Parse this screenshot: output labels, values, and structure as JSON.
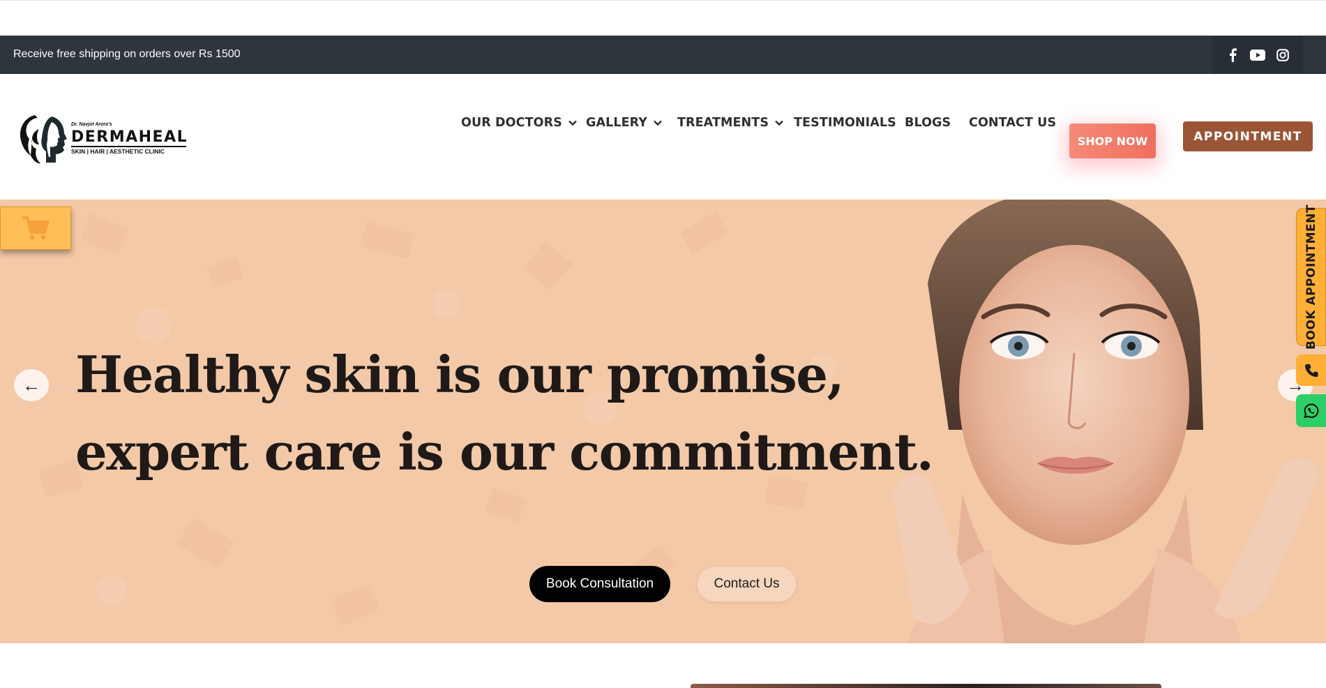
{
  "topbar": {
    "promo_text": "Receive free shipping on orders over Rs 1500",
    "social_icons": [
      "facebook-icon",
      "youtube-icon",
      "instagram-icon"
    ]
  },
  "header": {
    "logo": {
      "small_text": "Dr. Navjot Arora's",
      "brand": "DERMAHEAL",
      "tagline": "SKIN | HAIR | AESTHETIC CLINIC"
    },
    "nav": [
      {
        "label": "OUR DOCTORS",
        "has_dropdown": true
      },
      {
        "label": "GALLERY",
        "has_dropdown": true
      },
      {
        "label": "TREATMENTS",
        "has_dropdown": true
      },
      {
        "label": "TESTIMONIALS",
        "has_dropdown": false
      },
      {
        "label": "BLOGS",
        "has_dropdown": false
      },
      {
        "label": "CONTACT US",
        "has_dropdown": false
      }
    ],
    "shop_button": "SHOP NOW",
    "appointment_button": "APPOINTMENT"
  },
  "hero": {
    "headline_line1": "Healthy skin is our promise,",
    "headline_line2": "expert care is our commitment.",
    "prev_arrow": "←",
    "next_arrow": "→",
    "primary_button": "Book Consultation",
    "secondary_button": "Contact Us"
  },
  "floating": {
    "cart_icon": "shopping-cart-icon",
    "book_appointment": "BOOK APPOINTMENT",
    "phone_icon": "phone-icon",
    "whatsapp_icon": "whatsapp-icon"
  },
  "colors": {
    "topbar_bg": "#2e353d",
    "hero_bg": "#f3c9a8",
    "shop_button": "#f27a68",
    "appointment_button": "#9a5537",
    "floating_orange": "#ffae36",
    "whatsapp_green": "#2ecf67"
  }
}
